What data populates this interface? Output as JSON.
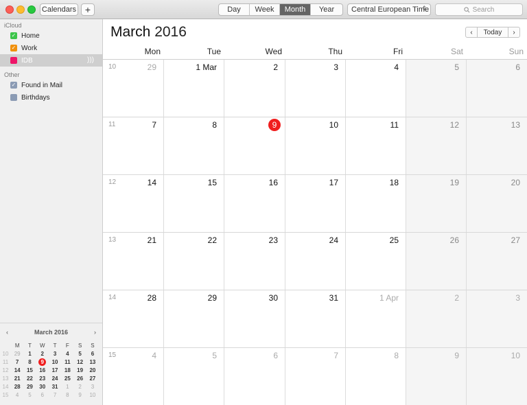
{
  "toolbar": {
    "calendars_label": "Calendars",
    "add_label": "+",
    "views": [
      "Day",
      "Week",
      "Month",
      "Year"
    ],
    "active_view": "Month",
    "timezone": "Central European Time",
    "search_placeholder": "Search"
  },
  "sidebar": {
    "group_icloud": "iCloud",
    "group_other": "Other",
    "calendars": [
      {
        "label": "Home",
        "color": "#3cc54a",
        "checked": true
      },
      {
        "label": "Work",
        "color": "#f0900c",
        "checked": true
      },
      {
        "label": "IDB",
        "color": "#ee1568",
        "checked": false,
        "selected": true
      }
    ],
    "other_calendars": [
      {
        "label": "Found in Mail",
        "color": "#8b9bb4",
        "checked": true
      },
      {
        "label": "Birthdays",
        "color": "#8b9bb4",
        "checked": false
      }
    ]
  },
  "mini_calendar": {
    "title": "March 2016",
    "prev": "‹",
    "next": "›",
    "headers": [
      "M",
      "T",
      "W",
      "T",
      "F",
      "S",
      "S"
    ],
    "weeks": [
      {
        "wk": "10",
        "days": [
          "29",
          "1",
          "2",
          "3",
          "4",
          "5",
          "6"
        ]
      },
      {
        "wk": "11",
        "days": [
          "7",
          "8",
          "9",
          "10",
          "11",
          "12",
          "13"
        ]
      },
      {
        "wk": "12",
        "days": [
          "14",
          "15",
          "16",
          "17",
          "18",
          "19",
          "20"
        ]
      },
      {
        "wk": "13",
        "days": [
          "21",
          "22",
          "23",
          "24",
          "25",
          "26",
          "27"
        ]
      },
      {
        "wk": "14",
        "days": [
          "28",
          "29",
          "30",
          "31",
          "1",
          "2",
          "3"
        ]
      },
      {
        "wk": "15",
        "days": [
          "4",
          "5",
          "6",
          "7",
          "8",
          "9",
          "10"
        ]
      }
    ]
  },
  "main": {
    "month": "March",
    "year": "2016",
    "today_label": "Today",
    "prev": "‹",
    "next": "›",
    "dow": [
      "Mon",
      "Tue",
      "Wed",
      "Thu",
      "Fri",
      "Sat",
      "Sun"
    ],
    "weeks": [
      {
        "wk": "10",
        "days": [
          "29",
          "1 Mar",
          "2",
          "3",
          "4",
          "5",
          "6"
        ]
      },
      {
        "wk": "11",
        "days": [
          "7",
          "8",
          "9",
          "10",
          "11",
          "12",
          "13"
        ]
      },
      {
        "wk": "12",
        "days": [
          "14",
          "15",
          "16",
          "17",
          "18",
          "19",
          "20"
        ]
      },
      {
        "wk": "13",
        "days": [
          "21",
          "22",
          "23",
          "24",
          "25",
          "26",
          "27"
        ]
      },
      {
        "wk": "14",
        "days": [
          "28",
          "29",
          "30",
          "31",
          "1 Apr",
          "2",
          "3"
        ]
      },
      {
        "wk": "15",
        "days": [
          "4",
          "5",
          "6",
          "7",
          "8",
          "9",
          "10"
        ]
      }
    ],
    "today_highlight_color": "#f01e1e"
  }
}
